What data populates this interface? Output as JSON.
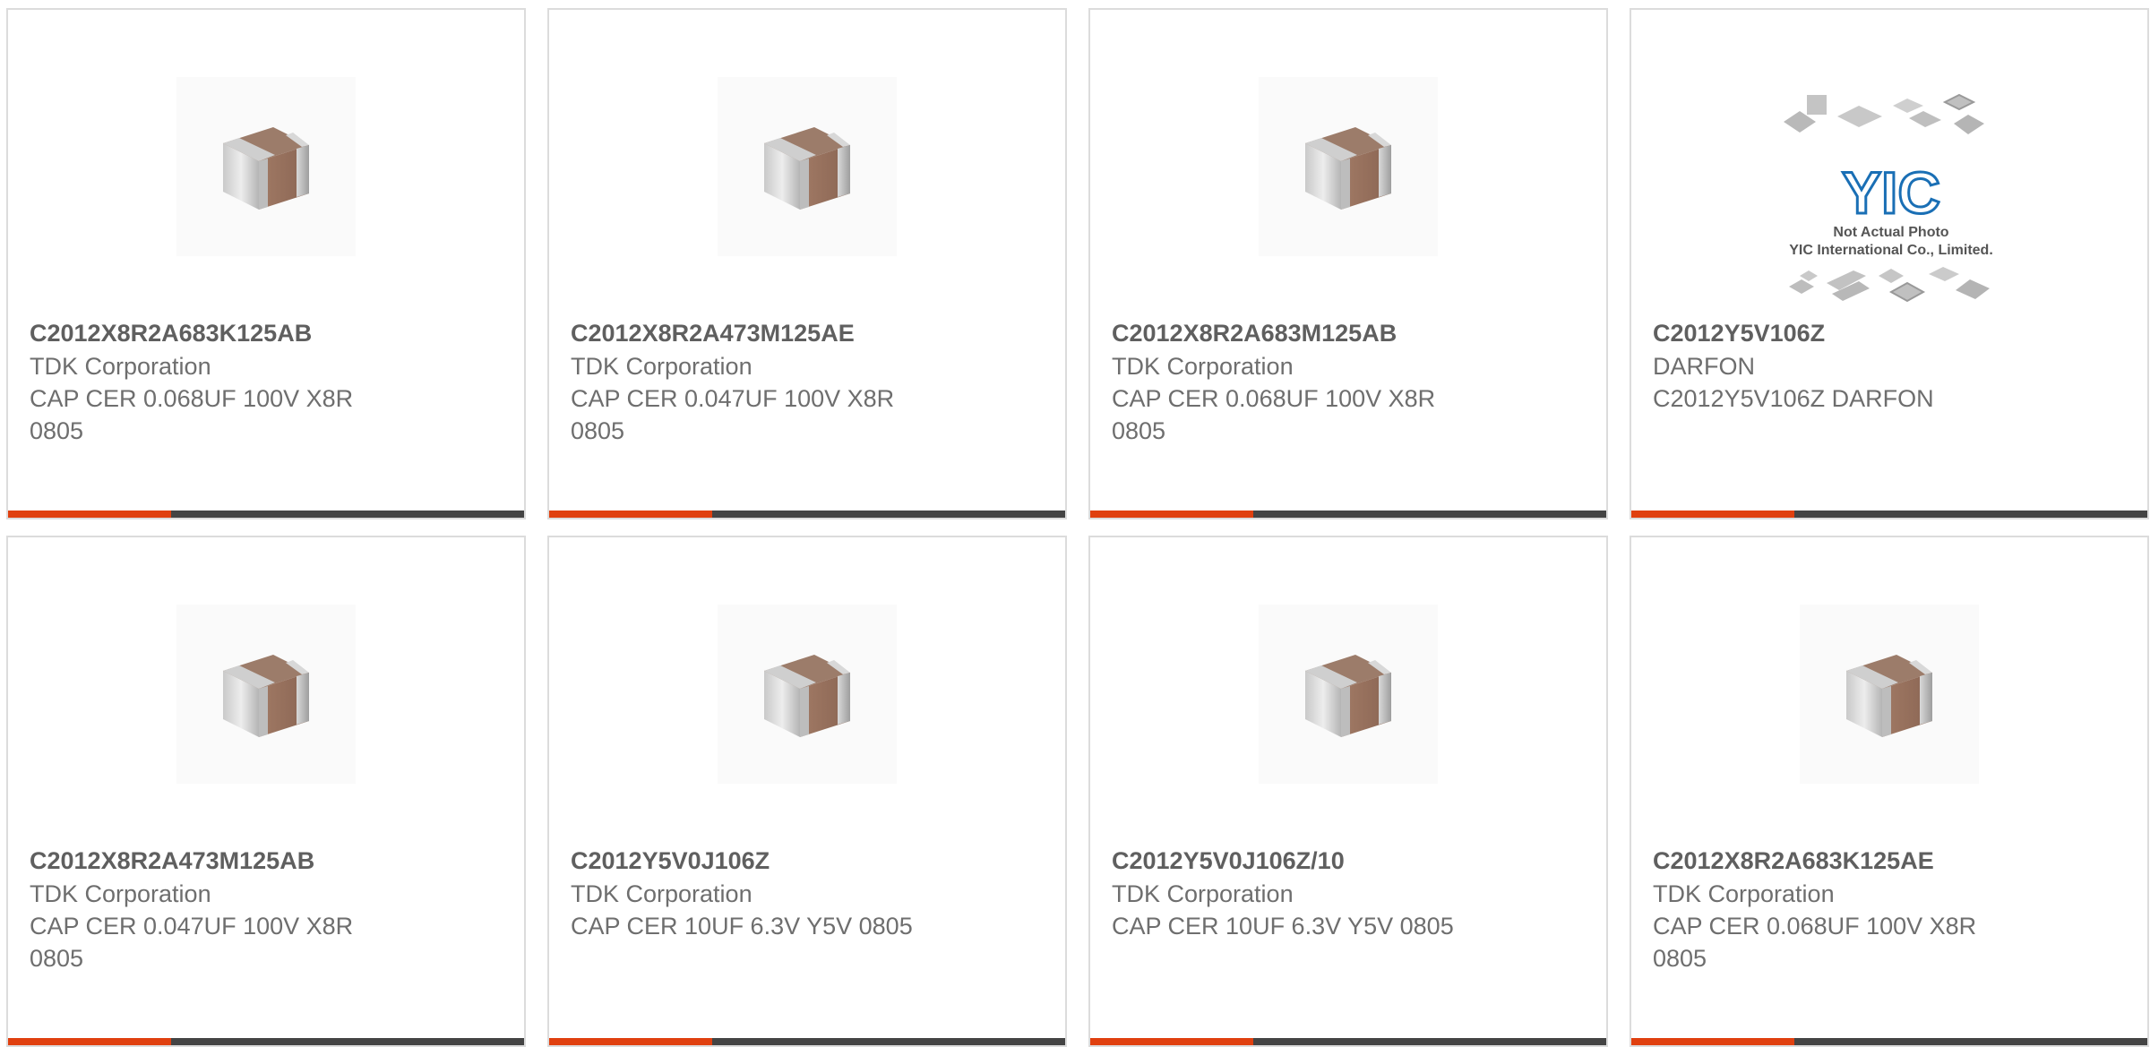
{
  "colors": {
    "accent": "#e0400f",
    "bar": "#444444",
    "border": "#dcdcdc",
    "part_number": "#5f5f5f",
    "text": "#6e6e6e"
  },
  "products": [
    {
      "part_number": "C2012X8R2A683K125AB",
      "manufacturer": "TDK Corporation",
      "description": "CAP CER 0.068UF 100V X8R 0805",
      "image": "chip-capacitor-icon"
    },
    {
      "part_number": "C2012X8R2A473M125AE",
      "manufacturer": "TDK Corporation",
      "description": "CAP CER 0.047UF 100V X8R 0805",
      "image": "chip-capacitor-icon"
    },
    {
      "part_number": "C2012X8R2A683M125AB",
      "manufacturer": "TDK Corporation",
      "description": "CAP CER 0.068UF 100V X8R 0805",
      "image": "chip-capacitor-icon"
    },
    {
      "part_number": "C2012Y5V106Z",
      "manufacturer": "DARFON",
      "description": "C2012Y5V106Z DARFON",
      "image": "yic-placeholder-icon",
      "image_text": {
        "logo": "YIC",
        "line1": "Not Actual Photo",
        "line2": "YIC International Co., Limited."
      }
    },
    {
      "part_number": "C2012X8R2A473M125AB",
      "manufacturer": "TDK Corporation",
      "description": "CAP CER 0.047UF 100V X8R 0805",
      "image": "chip-capacitor-icon"
    },
    {
      "part_number": "C2012Y5V0J106Z",
      "manufacturer": "TDK Corporation",
      "description": "CAP CER 10UF 6.3V Y5V 0805",
      "image": "chip-capacitor-icon"
    },
    {
      "part_number": "C2012Y5V0J106Z/10",
      "manufacturer": "TDK Corporation",
      "description": "CAP CER 10UF 6.3V Y5V 0805",
      "image": "chip-capacitor-icon"
    },
    {
      "part_number": "C2012X8R2A683K125AE",
      "manufacturer": "TDK Corporation",
      "description": "CAP CER 0.068UF 100V X8R 0805",
      "image": "chip-capacitor-icon"
    }
  ]
}
